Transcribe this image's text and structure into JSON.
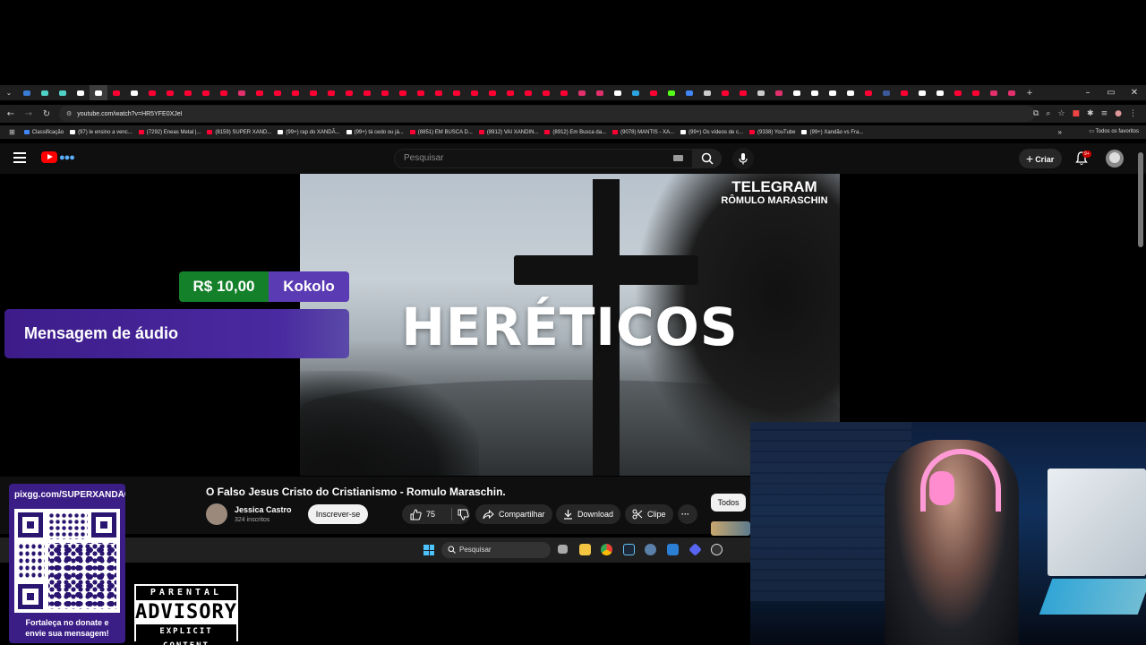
{
  "browser": {
    "tab_colors": [
      "#3a7bd5",
      "#4fd1c5",
      "#4fd1c5",
      "#ffffff",
      "#ffffff",
      "#ff0033",
      "#ffffff",
      "#ff0033",
      "#ff0033",
      "#ff0033",
      "#ff0033",
      "#ff0033",
      "#e1306c",
      "#ff0033",
      "#ff0033",
      "#ff0033",
      "#ff0033",
      "#ff0033",
      "#ff0033",
      "#ff0033",
      "#ff0033",
      "#ff0033",
      "#ff0033",
      "#ff0033",
      "#ff0033",
      "#ff0033",
      "#ff0033",
      "#ff0033",
      "#ff0033",
      "#ff0033",
      "#ff0033",
      "#e1306c",
      "#e1306c",
      "#ffffff",
      "#2aa3e0",
      "#ff0033",
      "#53fc18",
      "#4285f4",
      "#cccccc",
      "#ff0033",
      "#ff0033",
      "#cccccc",
      "#e1306c",
      "#ffffff",
      "#ffffff",
      "#ffffff",
      "#ffffff",
      "#ff0033",
      "#3b5998",
      "#ff0033",
      "#ffffff",
      "#ffffff",
      "#ff0033",
      "#ff0033",
      "#e1306c",
      "#e1306c"
    ],
    "new_tab": "+",
    "window_controls": [
      "–",
      "▭",
      "✕"
    ],
    "url": "youtube.com/watch?v=HR5YFE0XJeI",
    "bookmarks": [
      {
        "label": "Classificação",
        "color": "#4285f4"
      },
      {
        "label": "(97) le ensino a venc...",
        "color": "#ffffff"
      },
      {
        "label": "(7292) Eneas Metal |...",
        "color": "#ff0033"
      },
      {
        "label": "(8159) SUPER XAND...",
        "color": "#ff0033"
      },
      {
        "label": "(99+) rap do XANDÃ...",
        "color": "#ffffff"
      },
      {
        "label": "(99+) tá cedo ou já...",
        "color": "#ffffff"
      },
      {
        "label": "(8851) EM BUSCA D...",
        "color": "#ff0033"
      },
      {
        "label": "(8912) VAI XANDIN...",
        "color": "#ff0033"
      },
      {
        "label": "(8912) Em Busca da...",
        "color": "#ff0033"
      },
      {
        "label": "(9078) MANTIS - XA...",
        "color": "#ff0033"
      },
      {
        "label": "(99+) Os vídeos de c...",
        "color": "#ffffff"
      },
      {
        "label": "(9338) YouTube",
        "color": "#ff0033"
      },
      {
        "label": "(99+) Xandão vs Fra...",
        "color": "#ffffff"
      }
    ],
    "bookmarks_more": "»",
    "bookmarks_folder": "Todos os favoritos"
  },
  "youtube": {
    "search_placeholder": "Pesquisar",
    "create_label": "Criar",
    "notif_badge": "9+",
    "video": {
      "overlay_title": "HERÉTICOS",
      "telegram_line1": "TELEGRAM",
      "telegram_line2": "RÔMULO MARASCHIN"
    },
    "title": "O Falso Jesus Cristo do Cristianismo - Romulo Maraschin.",
    "channel": "Jessica Castro",
    "subscribers": "324 inscritos",
    "subscribe_label": "Inscrever-se",
    "likes": "75",
    "share_label": "Compartilhar",
    "download_label": "Download",
    "clip_label": "Clipe",
    "more_label": "···",
    "filter_all": "Todos"
  },
  "donation": {
    "amount": "R$ 10,00",
    "donor": "Kokolo",
    "message": "Mensagem de áudio"
  },
  "taskbar": {
    "search_label": "Pesquisar"
  },
  "stream_overlay": {
    "qr_url": "pixgg.com/SUPERXANDÃO",
    "qr_caption_line1": "Fortaleça no donate e",
    "qr_caption_line2": "envie sua mensagem!",
    "advisory_top": "PARENTAL",
    "advisory_mid": "ADVISORY",
    "advisory_bottom": "EXPLICIT CONTENT"
  }
}
